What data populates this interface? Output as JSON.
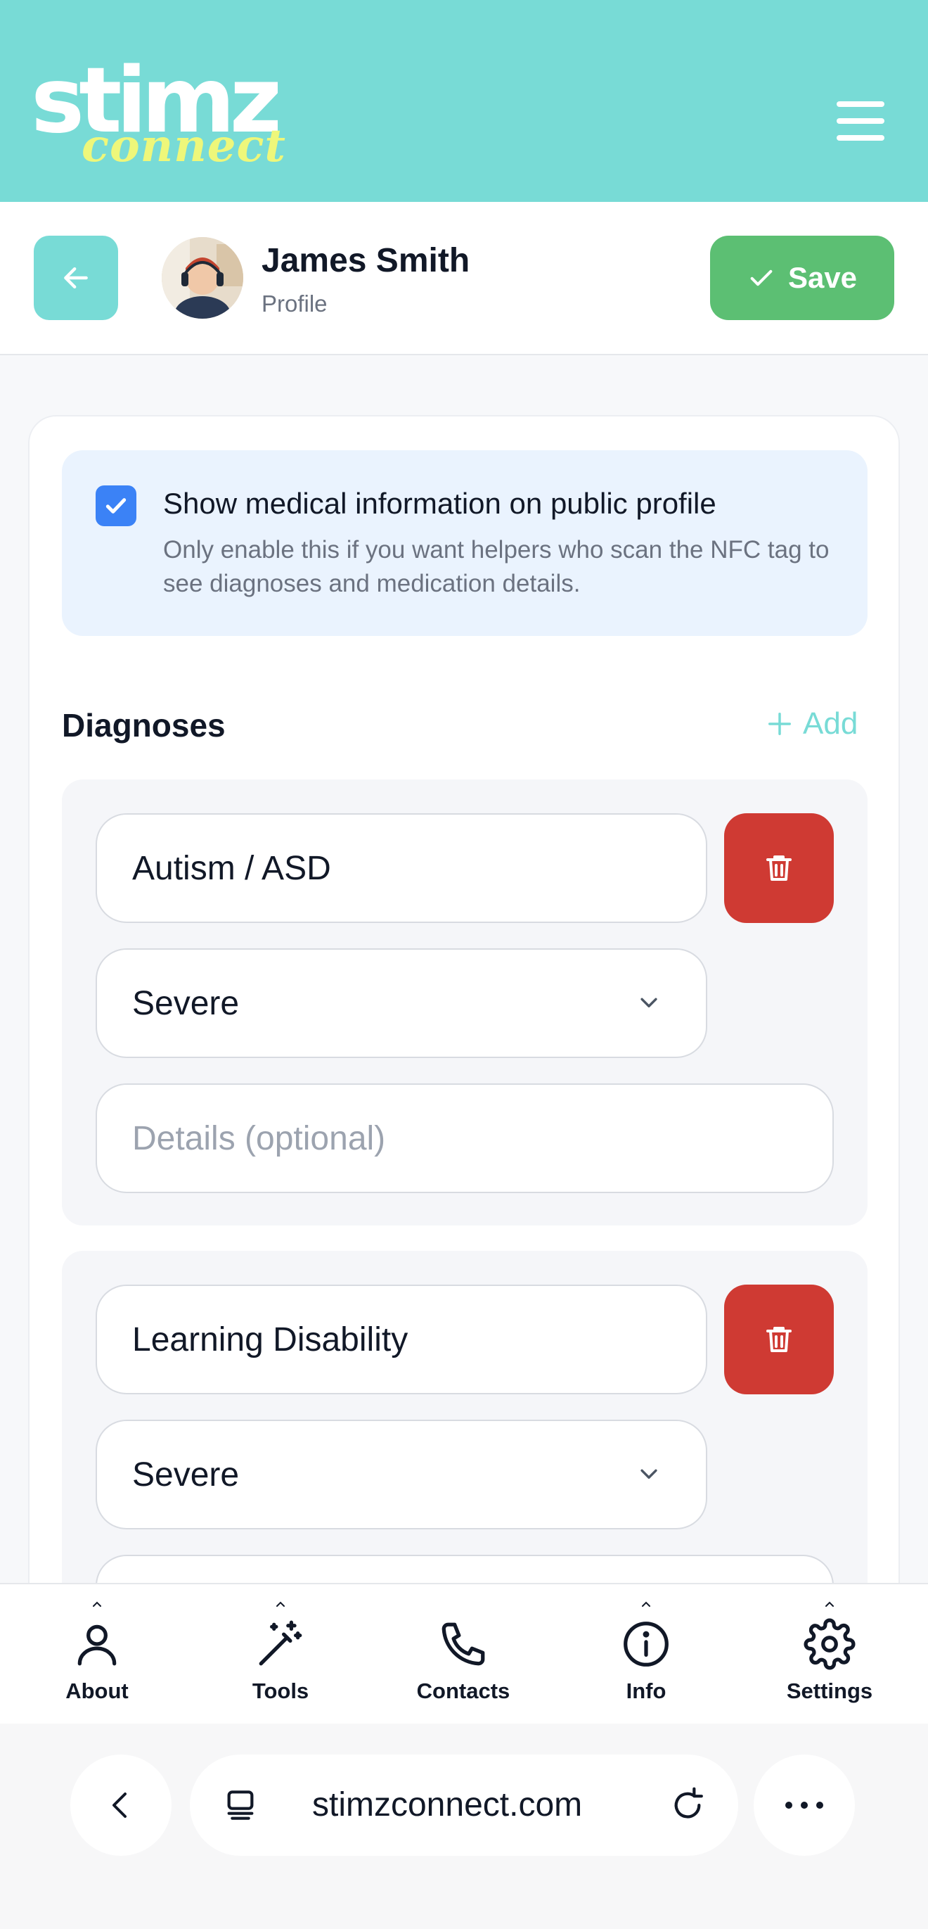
{
  "header": {
    "logo_main": "stimz",
    "logo_sub": "connect",
    "background": "#78dbd6"
  },
  "profile": {
    "name": "James Smith",
    "subtitle": "Profile",
    "save_label": "Save"
  },
  "notice": {
    "checked": true,
    "title": "Show medical information on public profile",
    "body": "Only enable this if you want helpers who scan the NFC tag to see diagnoses and medication details."
  },
  "diagnoses": {
    "title": "Diagnoses",
    "add_label": "Add",
    "details_placeholder": "Details (optional)",
    "items": [
      {
        "name": "Autism / ASD",
        "severity": "Severe"
      },
      {
        "name": "Learning Disability",
        "severity": "Severe"
      }
    ]
  },
  "bottom_nav": {
    "items": [
      {
        "label": "About",
        "icon": "person-icon"
      },
      {
        "label": "Tools",
        "icon": "magic-wand-icon"
      },
      {
        "label": "Contacts",
        "icon": "phone-icon"
      },
      {
        "label": "Info",
        "icon": "info-icon"
      },
      {
        "label": "Settings",
        "icon": "gear-icon"
      }
    ]
  },
  "browser": {
    "url": "stimzconnect.com"
  },
  "colors": {
    "accent": "#78dbd6",
    "save": "#5cbf73",
    "delete": "#cf3a33",
    "checkbox": "#3b82f6"
  }
}
